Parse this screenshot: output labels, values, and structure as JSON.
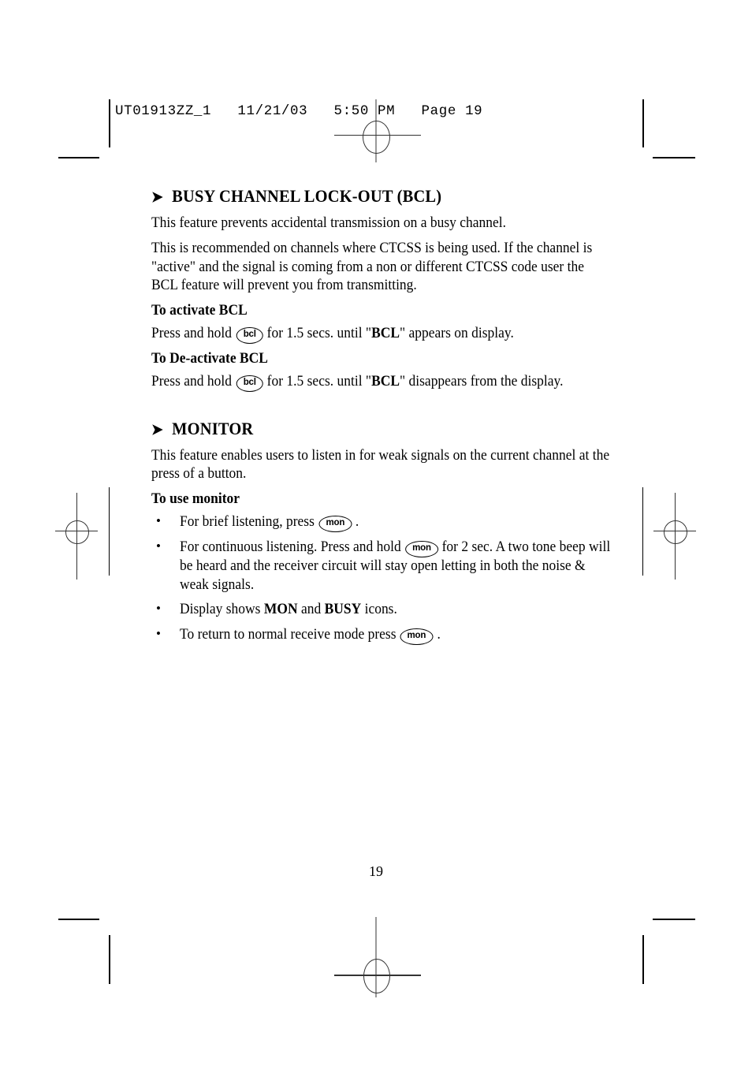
{
  "printer_slug": "UT01913ZZ_1   11/21/03   5:50 PM   Page 19",
  "page_number": "19",
  "arrow_glyph": "➤",
  "sections": [
    {
      "heading": "BUSY CHANNEL LOCK-OUT (BCL)",
      "paragraph1": "This feature prevents accidental transmission on a busy channel.",
      "paragraph2": "This is recommended on channels where CTCSS is being used. If the channel is \"active\" and the signal is coming from a non or different CTCSS code user the BCL feature will prevent you from transmitting.",
      "sub1": "To activate BCL",
      "activate_pre": "Press and hold",
      "activate_key": "bcl",
      "activate_mid": "for 1.5 secs. until \"",
      "activate_bold": "BCL",
      "activate_post": "\" appears on display.",
      "sub2": "To De-activate BCL",
      "deactivate_pre": "Press and hold",
      "deactivate_key": "bcl",
      "deactivate_mid": "for 1.5 secs. until \"",
      "deactivate_bold": "BCL",
      "deactivate_post": "\" disappears from the display."
    },
    {
      "heading": "MONITOR",
      "paragraph1": "This feature enables users to listen in for weak signals on the current channel at the press of a button.",
      "sub1": "To use monitor",
      "bullets": [
        {
          "pre": "For brief listening, press",
          "key": "mon",
          "post": "."
        },
        {
          "pre": "For continuous listening. Press and hold",
          "key": "mon",
          "post": "for 2 sec. A two tone beep will be heard and the receiver circuit will stay open letting in both the noise & weak signals."
        },
        {
          "pre": "Display shows",
          "bold1": "MON",
          "mid": "and",
          "bold2": "BUSY",
          "post": "icons."
        },
        {
          "pre": "To return to normal receive mode press",
          "key": "mon",
          "post": "."
        }
      ]
    }
  ],
  "colors": {
    "ink": "#000000",
    "registration_gray": "#999999",
    "registration_dark": "#333333"
  }
}
